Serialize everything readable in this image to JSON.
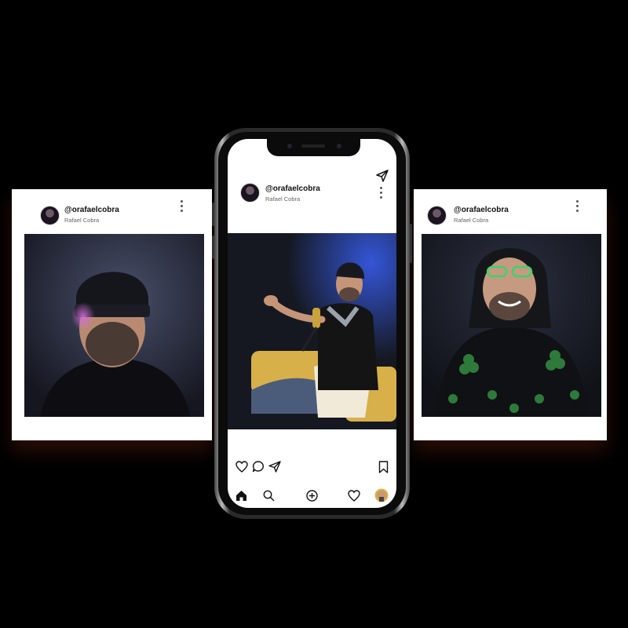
{
  "profile": {
    "handle": "@orafaelcobra",
    "name": "Rafael Cobra"
  },
  "left_card": {
    "handle": "@orafaelcobra",
    "name": "Rafael Cobra"
  },
  "phone_post": {
    "handle": "@orafaelcobra",
    "name": "Rafael Cobra"
  },
  "right_card": {
    "handle": "@orafaelcobra",
    "name": "Rafael Cobra"
  },
  "icons": {
    "post_actions": [
      "heart-icon",
      "comment-icon",
      "share-icon",
      "bookmark-icon"
    ],
    "bottom_nav": [
      "home-icon",
      "search-icon",
      "add-post-icon",
      "activity-heart-icon",
      "profile-avatar"
    ],
    "header": [
      "direct-message-icon",
      "more-options-icon"
    ]
  },
  "colors": {
    "card": "#ffffff",
    "background": "#000000",
    "accent_glow": "#7a4dff"
  }
}
